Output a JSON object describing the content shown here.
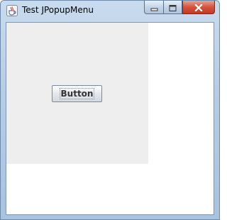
{
  "window": {
    "title": "Test JPopupMenu",
    "app_icon": "java-cup-icon",
    "caption_icons": {
      "minimize": "minimize-icon",
      "maximize": "maximize-icon",
      "close": "close-icon"
    }
  },
  "panel": {
    "button_label": "Button"
  },
  "colors": {
    "panel_background": "#eeeeee",
    "client_background": "#ffffff",
    "close_button": "#c9442f"
  }
}
